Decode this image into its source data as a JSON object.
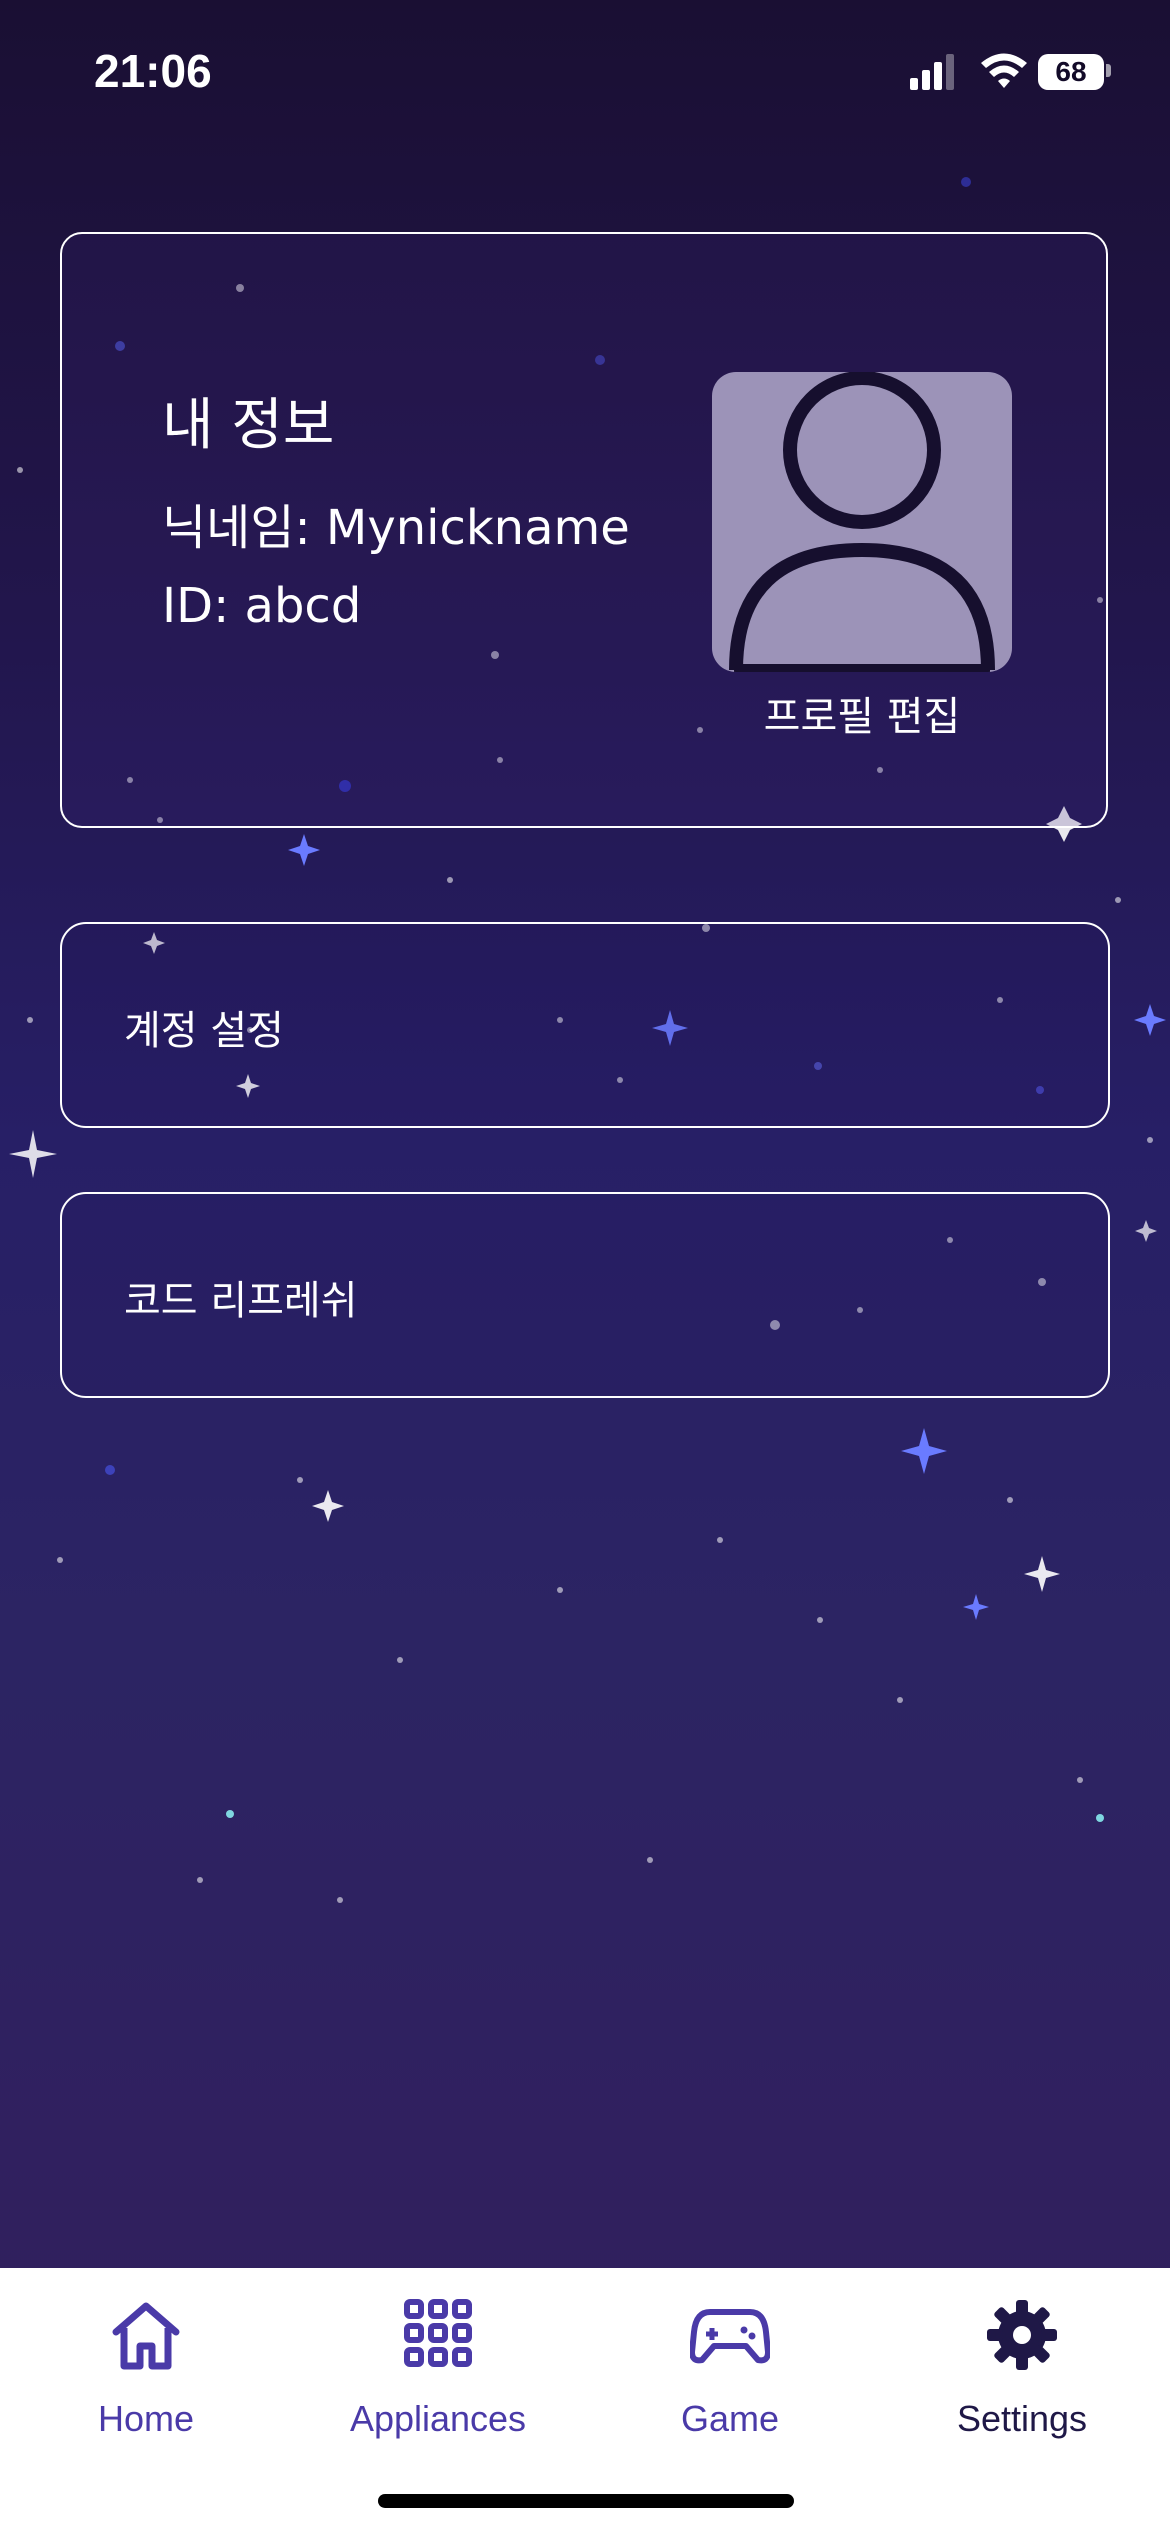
{
  "status_bar": {
    "time": "21:06",
    "battery": "68",
    "icons": [
      "signal-icon",
      "wifi-icon",
      "battery-icon"
    ]
  },
  "profile_card": {
    "title": "내 정보",
    "nickname": "닉네임: Mynickname",
    "id": "ID: abcd",
    "avatar_icon": "user-avatar-icon",
    "edit_label": "프로필 편집"
  },
  "menu": {
    "items": [
      {
        "label": "계정 설정"
      },
      {
        "label": "코드 리프레쉬"
      }
    ]
  },
  "tabbar": {
    "tabs": [
      {
        "label": "Home",
        "icon": "home-icon"
      },
      {
        "label": "Appliances",
        "icon": "grid-icon"
      },
      {
        "label": "Game",
        "icon": "gamepad-icon"
      },
      {
        "label": "Settings",
        "icon": "gear-icon"
      }
    ],
    "active": "Settings"
  },
  "colors": {
    "background_top": "#1a0f33",
    "background_mid": "#271f66",
    "tab_accent": "#4a3aa8",
    "tab_active": "#1f1847",
    "avatar_bg": "#9c93b8"
  }
}
